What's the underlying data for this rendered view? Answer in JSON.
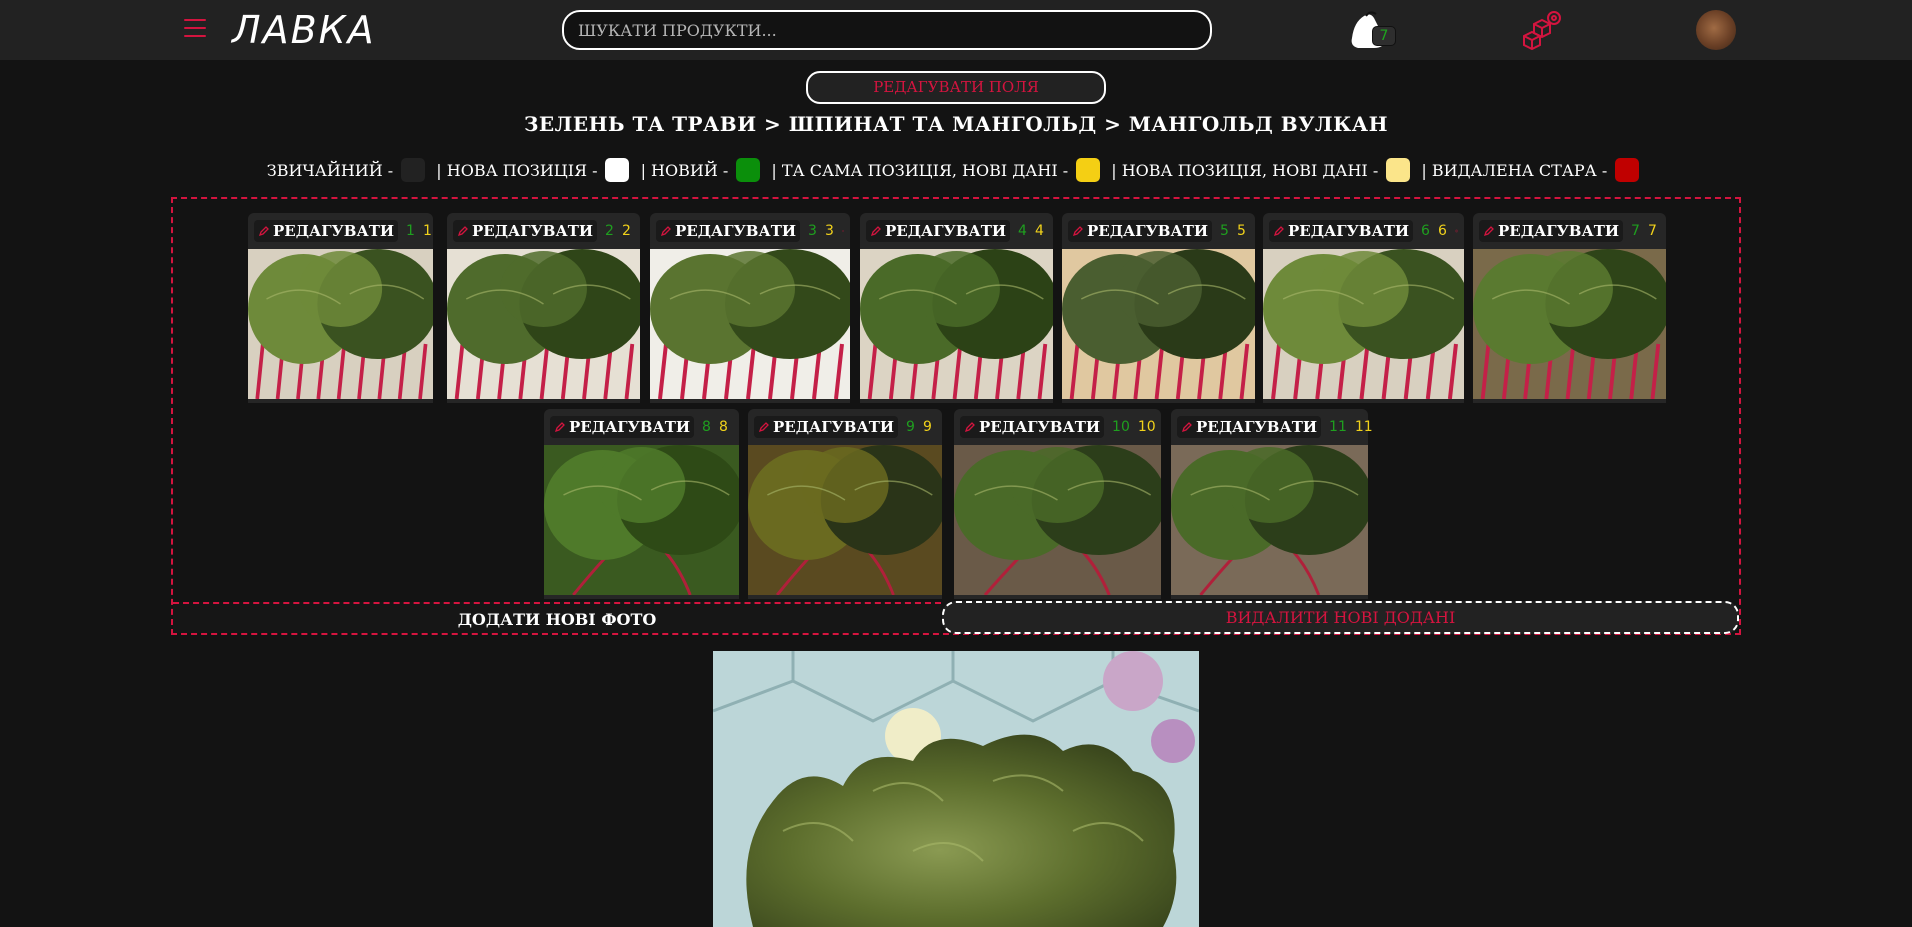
{
  "header": {
    "logo": "ЛАВКА",
    "search_placeholder": "шукати продукти...",
    "cart_count": "7"
  },
  "edit_fields_label": "редагувати поля",
  "breadcrumb": "ЗЕЛЕНЬ ТА ТРАВИ > ШПИНАТ ТА МАНГОЛЬД > МАНГОЛЬД ВУЛКАН",
  "legend": [
    {
      "label": "звичайний -",
      "color": "#222222"
    },
    {
      "label": "| нова позиція -",
      "color": "#ffffff"
    },
    {
      "label": "| новий -",
      "color": "#0b8f0b"
    },
    {
      "label": "| та сама позиція, нові дані -",
      "color": "#f4cf14"
    },
    {
      "label": "| нова позиція, нові дані -",
      "color": "#fbe58a"
    },
    {
      "label": "| видалена стара -",
      "color": "#c00000"
    }
  ],
  "photos": [
    {
      "label": "РЕДАГУВАТИ",
      "n1": "1",
      "n2": "1"
    },
    {
      "label": "РЕДАГУВАТИ",
      "n1": "2",
      "n2": "2"
    },
    {
      "label": "РЕДАГУВАТИ",
      "n1": "3",
      "n2": "3"
    },
    {
      "label": "РЕДАГУВАТИ",
      "n1": "4",
      "n2": "4"
    },
    {
      "label": "РЕДАГУВАТИ",
      "n1": "5",
      "n2": "5"
    },
    {
      "label": "РЕДАГУВАТИ",
      "n1": "6",
      "n2": "6"
    },
    {
      "label": "РЕДАГУВАТИ",
      "n1": "7",
      "n2": "7"
    },
    {
      "label": "РЕДАГУВАТИ",
      "n1": "8",
      "n2": "8"
    },
    {
      "label": "РЕДАГУВАТИ",
      "n1": "9",
      "n2": "9"
    },
    {
      "label": "РЕДАГУВАТИ",
      "n1": "10",
      "n2": "10"
    },
    {
      "label": "РЕДАГУВАТИ",
      "n1": "11",
      "n2": "11"
    }
  ],
  "add_photos_label": "додати нові фото",
  "delete_new_label": "видалити нові додані",
  "colors": {
    "accent": "#d4143f",
    "green": "#1f9f1f",
    "yellow": "#f1d21b",
    "bg": "#131313",
    "header": "#222222"
  }
}
